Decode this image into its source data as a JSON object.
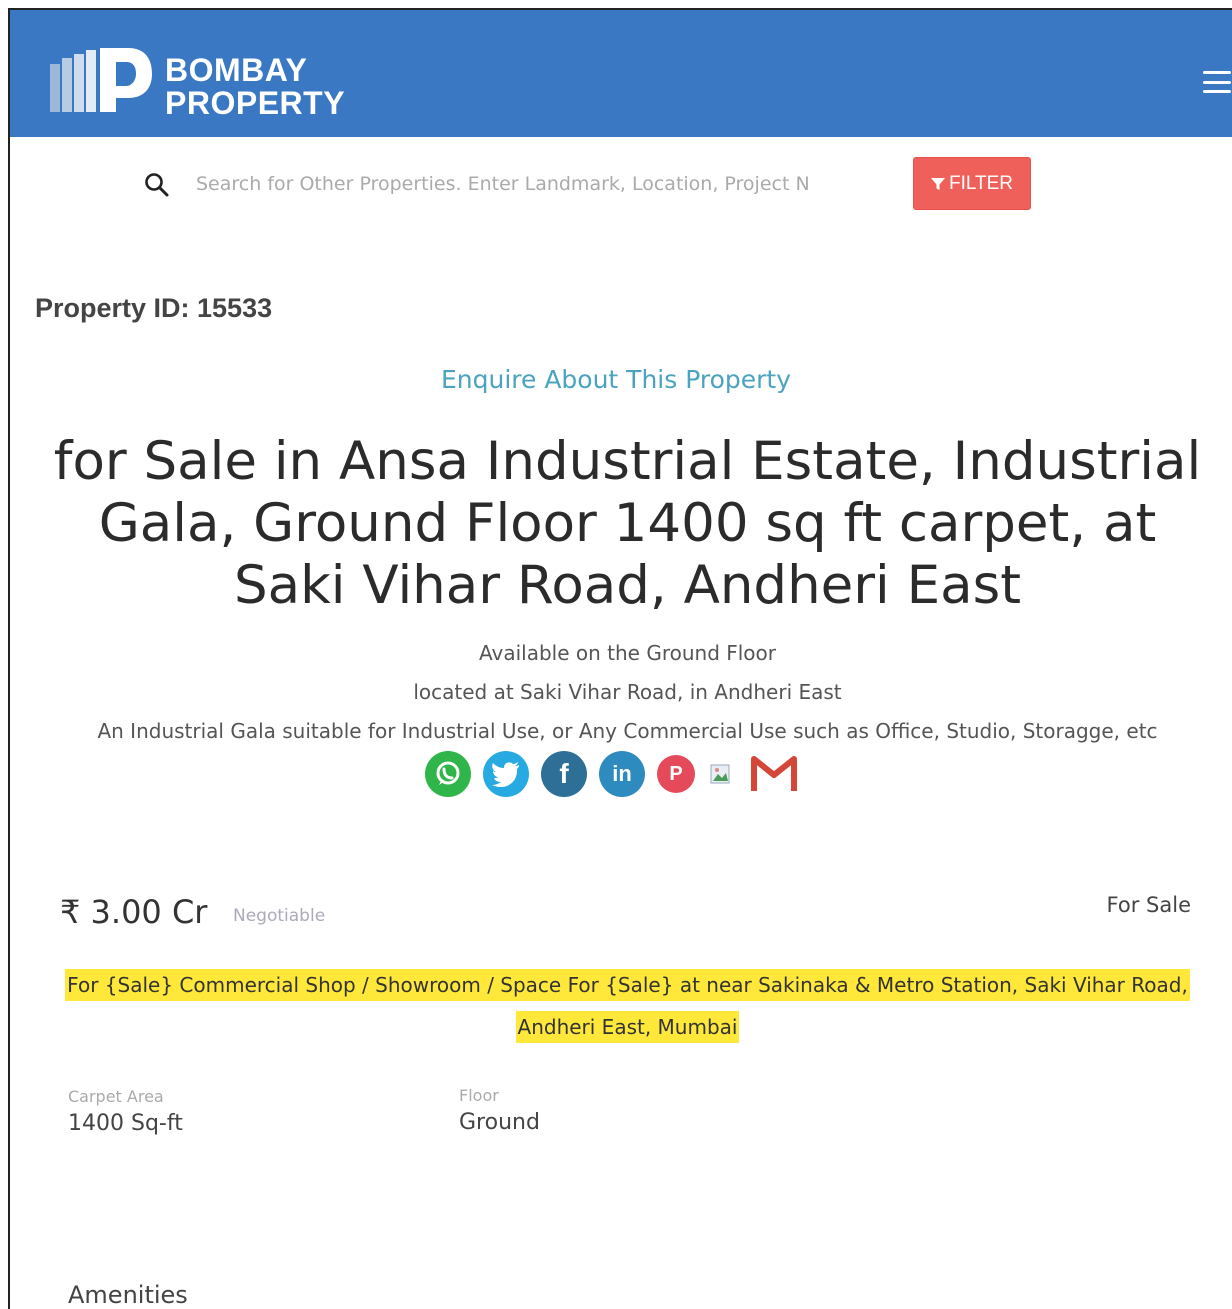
{
  "header": {
    "brand_line1": "BOMBAY",
    "brand_line2": "PROPERTY",
    "menu_icon": "hamburger-icon",
    "bg_color": "#3a78c4"
  },
  "search": {
    "placeholder": "Search for Other Properties. Enter Landmark, Location, Project N",
    "filter_label": "FILTER",
    "filter_color": "#f0605a"
  },
  "property": {
    "id_label": "Property ID: 15533",
    "enquire_label": "Enquire About This Property",
    "title": "for Sale in Ansa Industrial Estate, Industrial Gala, Ground Floor 1400 sq ft carpet, at Saki Vihar Road, Andheri East",
    "desc_line1": "Available on the Ground Floor",
    "desc_line2": "located at Saki Vihar Road, in Andheri East",
    "desc_line3": "An Industrial Gala suitable for Industrial Use, or Any Commercial Use such as Office, Studio, Storagge, etc",
    "price": "₹ 3.00 Cr",
    "negotiable": "Negotiable",
    "status": "For Sale",
    "highlight_line1": "For {Sale} Commercial Shop / Showroom / Space For {Sale} at near Sakinaka & Metro Station, Saki Vihar Road,",
    "highlight_line2": "Andheri East, Mumbai",
    "highlight_color": "#ffe83a"
  },
  "share": [
    "whatsapp-icon",
    "twitter-icon",
    "facebook-icon",
    "linkedin-icon",
    "pinterest-icon",
    "broken-image-icon",
    "gmail-icon"
  ],
  "details": {
    "carpet_label": "Carpet Area",
    "carpet_value": "1400 Sq-ft",
    "floor_label": "Floor",
    "floor_value": "Ground"
  },
  "amenities_label": "Amenities"
}
